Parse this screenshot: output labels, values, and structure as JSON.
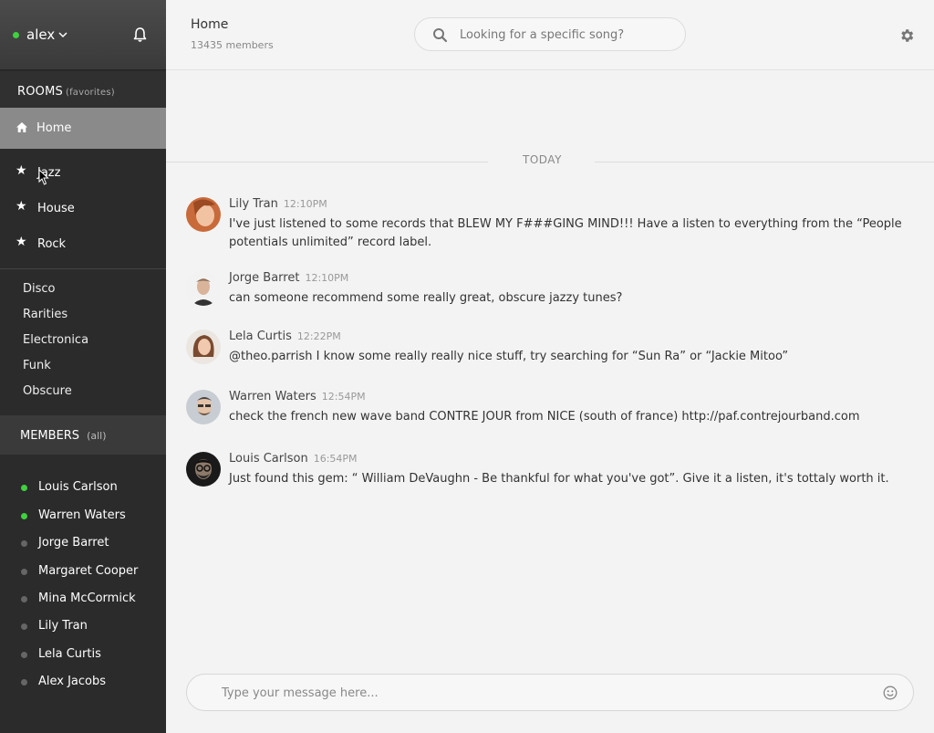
{
  "user": {
    "name": "alex",
    "status_color": "#3fd13f"
  },
  "rooms": {
    "title": "ROOMS",
    "subtitle": "(favorites)",
    "home": "Home",
    "favorites": [
      "Jazz",
      "House",
      "Rock"
    ],
    "others": [
      "Disco",
      "Rarities",
      "Electronica",
      "Funk",
      "Obscure"
    ]
  },
  "members": {
    "title": "MEMBERS",
    "subtitle": "(all)",
    "list": [
      {
        "name": "Louis Carlson",
        "online": true
      },
      {
        "name": "Warren Waters",
        "online": true
      },
      {
        "name": "Jorge Barret",
        "online": false
      },
      {
        "name": "Margaret Cooper",
        "online": false
      },
      {
        "name": "Mina McCormick",
        "online": false
      },
      {
        "name": "Lily Tran",
        "online": false
      },
      {
        "name": "Lela Curtis",
        "online": false
      },
      {
        "name": "Alex Jacobs",
        "online": false
      }
    ]
  },
  "header": {
    "room_title": "Home",
    "members_count": "13435 members",
    "search_placeholder": "Looking for a specific song?"
  },
  "chat": {
    "day_label": "TODAY",
    "messages": [
      {
        "author": "Lily Tran",
        "time": "12:10PM",
        "text": "I've just listened to some records that BLEW MY F###GING MIND!!! Have a listen to everything from the “People potentials unlimited” record label."
      },
      {
        "author": "Jorge Barret",
        "time": "12:10PM",
        "text": "can someone recommend some really great, obscure jazzy tunes?"
      },
      {
        "author": "Lela Curtis",
        "time": "12:22PM",
        "text": "@theo.parrish I know some really really nice stuff, try searching for “Sun Ra” or “Jackie Mitoo”"
      },
      {
        "author": "Warren Waters",
        "time": "12:54PM",
        "text": "check the french new wave band CONTRE JOUR from NICE (south of france) http://paf.contrejourband.com"
      },
      {
        "author": "Louis Carlson",
        "time": "16:54PM",
        "text": "Just found this gem: “ William DeVaughn - Be thankful for what you've got”. Give it a listen, it's tottaly worth it."
      }
    ]
  },
  "composer": {
    "placeholder": "Type your message here..."
  }
}
